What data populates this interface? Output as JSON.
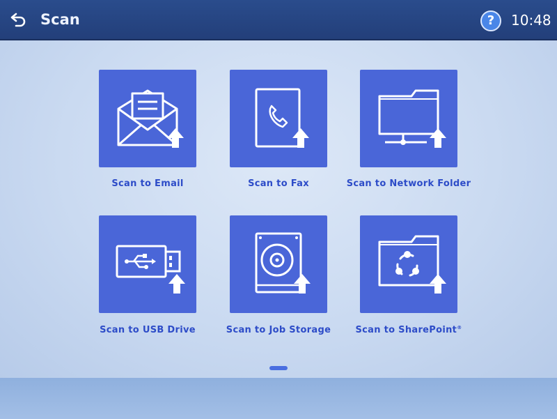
{
  "header": {
    "title": "Scan",
    "help_label": "?",
    "clock": "10:48"
  },
  "tiles": [
    {
      "label": "Scan to Email",
      "icon": "email-upload-icon"
    },
    {
      "label": "Scan to Fax",
      "icon": "fax-upload-icon"
    },
    {
      "label": "Scan to Network Folder",
      "icon": "network-folder-upload-icon"
    },
    {
      "label": "Scan to USB Drive",
      "icon": "usb-drive-upload-icon"
    },
    {
      "label": "Scan to Job Storage",
      "icon": "job-storage-upload-icon"
    },
    {
      "label": "Scan to SharePoint",
      "icon": "sharepoint-folder-upload-icon",
      "label_suffix": "®"
    }
  ],
  "colors": {
    "header_bg": "#233f7a",
    "tile_bg": "#4a66d8",
    "label_text": "#2d4cc8",
    "help_button": "#4a86e8"
  },
  "pagination": {
    "current_page": 1,
    "total_pages": 1
  }
}
